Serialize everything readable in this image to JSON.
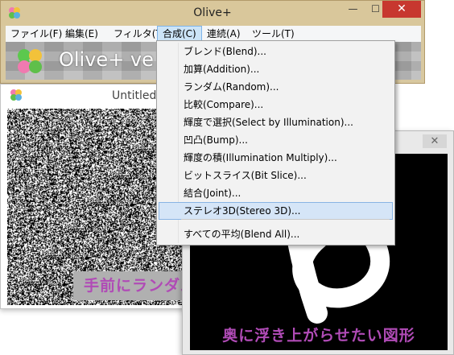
{
  "main_window": {
    "title": "Olive+",
    "controls": {
      "minimize": "—",
      "maximize": "☐",
      "close": "✕"
    },
    "menu": [
      {
        "label": "ファイル(F)"
      },
      {
        "label": "編集(E)"
      },
      {
        "label": "フィルタ(T)"
      },
      {
        "label": "合成(C)"
      },
      {
        "label": "連続(A)"
      },
      {
        "label": "ツール(T)"
      }
    ],
    "banner_text": "Olive+ ve"
  },
  "untitled_window": {
    "title": "Untitled",
    "caption": "手前にランダムドット"
  },
  "second_window": {
    "close": "✕",
    "caption": "奥に浮き上がらせたい図形"
  },
  "compose_menu": {
    "items": [
      {
        "label": "ブレンド(Blend)..."
      },
      {
        "label": "加算(Addition)..."
      },
      {
        "label": "ランダム(Random)..."
      },
      {
        "label": "比較(Compare)..."
      },
      {
        "label": "輝度で選択(Select by Illumination)..."
      },
      {
        "label": "凹凸(Bump)..."
      },
      {
        "label": "輝度の積(Illumination Multiply)..."
      },
      {
        "label": "ビットスライス(Bit Slice)..."
      },
      {
        "label": "結合(Joint)..."
      },
      {
        "label": "ステレオ3D(Stereo 3D)..."
      },
      {
        "label": "すべての平均(Blend All)..."
      }
    ],
    "highlighted": "ステレオ3D(Stereo 3D)..."
  },
  "colors": {
    "title_bar": "#d9c79b",
    "close_button": "#c7372f",
    "menu_active": "#cce4f7",
    "caption_purple": "#b04bb6",
    "menu_highlight": "#d5e5f7"
  },
  "icons": {
    "app": "clover-icon",
    "close": "close-icon"
  }
}
